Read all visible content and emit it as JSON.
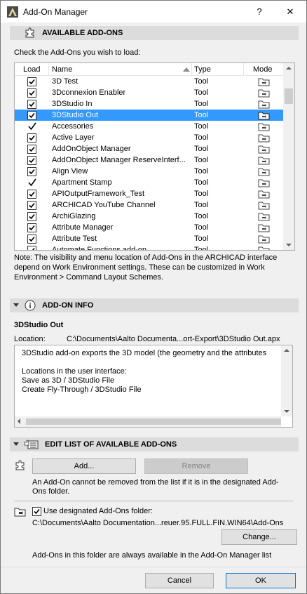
{
  "window": {
    "title": "Add-On Manager",
    "help_label": "?",
    "close_label": "✕"
  },
  "available": {
    "header": "AVAILABLE ADD-ONS",
    "instruction": "Check the Add-Ons you wish to load:",
    "columns": {
      "load": "Load",
      "name": "Name",
      "type": "Type",
      "mode": "Mode"
    },
    "rows": [
      {
        "name": "3D Test",
        "type": "Tool",
        "state": "checked"
      },
      {
        "name": "3Dconnexion Enabler",
        "type": "Tool",
        "state": "checked"
      },
      {
        "name": "3DStudio In",
        "type": "Tool",
        "state": "checked"
      },
      {
        "name": "3DStudio Out",
        "type": "Tool",
        "state": "checked",
        "selected": true
      },
      {
        "name": "Accessories",
        "type": "Tool",
        "state": "tick"
      },
      {
        "name": "Active Layer",
        "type": "Tool",
        "state": "checked"
      },
      {
        "name": "AddOnObject Manager",
        "type": "Tool",
        "state": "checked"
      },
      {
        "name": "AddOnObject Manager ReserveInterf...",
        "type": "Tool",
        "state": "checked"
      },
      {
        "name": "Align View",
        "type": "Tool",
        "state": "checked"
      },
      {
        "name": "Apartment Stamp",
        "type": "Tool",
        "state": "tick"
      },
      {
        "name": "APIOutputFramework_Test",
        "type": "Tool",
        "state": "checked"
      },
      {
        "name": "ARCHICAD YouTube Channel",
        "type": "Tool",
        "state": "checked"
      },
      {
        "name": "ArchiGlazing",
        "type": "Tool",
        "state": "checked"
      },
      {
        "name": "Attribute Manager",
        "type": "Tool",
        "state": "checked"
      },
      {
        "name": "Attribute Test",
        "type": "Tool",
        "state": "checked"
      },
      {
        "name": "Automate Functions add-on",
        "type": "Tool",
        "state": "checked"
      }
    ],
    "note": "Note: The visibility and menu location of Add-Ons in the ARCHICAD interface depend on Work Environment settings. These can be customized in Work Environment > Command Layout Schemes."
  },
  "info": {
    "header": "ADD-ON INFO",
    "selected_name": "3DStudio Out",
    "location_label": "Location:",
    "location_value": "C:\\Documents\\Aalto Documenta...ort-Export\\3DStudio Out.apx",
    "description": "3DStudio add-on exports the 3D model (the geometry and the attributes\n\nLocations in the user interface:\nSave as 3D / 3DStudio File\nCreate Fly-Through / 3DStudio File"
  },
  "edit": {
    "header": "EDIT LIST OF AVAILABLE ADD-ONS",
    "add_label": "Add...",
    "remove_label": "Remove",
    "remove_note": "An Add-On cannot be removed from the list if it is in the designated Add-Ons folder.",
    "use_folder_label": "Use designated Add-Ons folder:",
    "use_folder_checked": true,
    "folder_path": "C:\\Documents\\Aalto Documentation...reuer.95.FULL.FIN.WIN64\\Add-Ons",
    "change_label": "Change...",
    "folder_note": "Add-Ons in this folder are always available in the Add-On Manager list"
  },
  "footer": {
    "cancel_label": "Cancel",
    "ok_label": "OK"
  },
  "colors": {
    "selection": "#3399ff",
    "default_button_border": "#0078d7"
  }
}
